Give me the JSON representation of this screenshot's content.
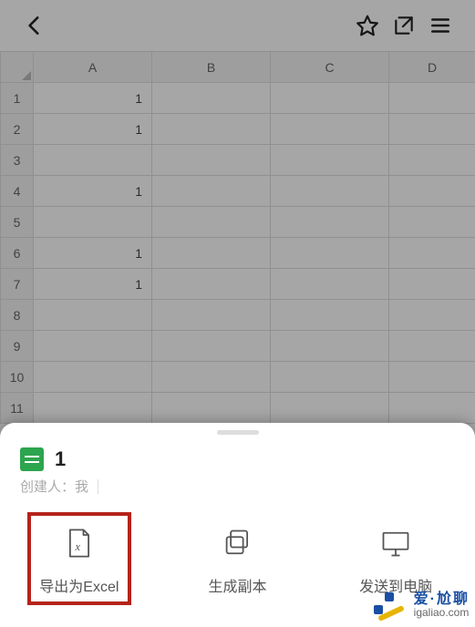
{
  "spreadsheet": {
    "columns": [
      "A",
      "B",
      "C",
      "D"
    ],
    "row_headers": [
      "1",
      "2",
      "3",
      "4",
      "5",
      "6",
      "7",
      "8",
      "9",
      "10",
      "11"
    ],
    "cells": {
      "r1": {
        "A": "1"
      },
      "r2": {
        "A": "1"
      },
      "r4": {
        "A": "1"
      },
      "r6": {
        "A": "1"
      },
      "r7": {
        "A": "1"
      }
    }
  },
  "sheet_panel": {
    "file_title": "1",
    "creator_label": "创建人：我",
    "actions": {
      "export_excel": "导出为Excel",
      "make_copy": "生成副本",
      "send_to_pc": "发送到电脑"
    }
  },
  "watermark": {
    "zh": "爱·尬聊",
    "en": "igaliao.com"
  }
}
